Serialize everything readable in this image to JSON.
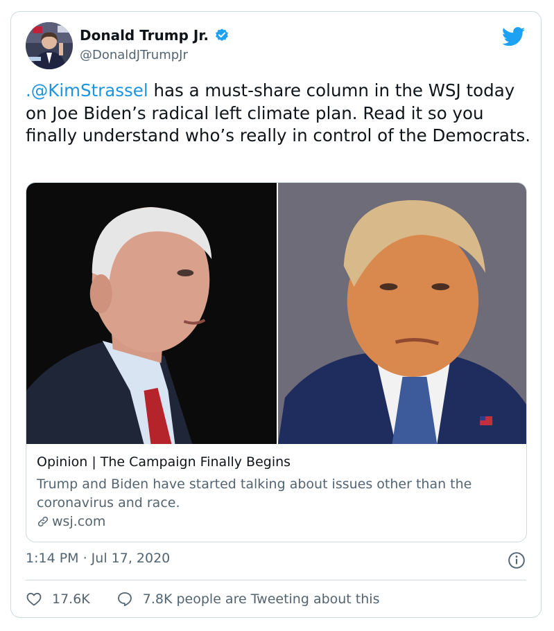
{
  "author": {
    "name": "Donald Trump Jr.",
    "handle": "@DonaldJTrumpJr"
  },
  "tweet": {
    "mention": ".@KimStrassel",
    "text": " has a must-share column in the WSJ today on Joe Biden’s radical left climate plan. Read it so you finally understand who’s really in control of the Democrats."
  },
  "card": {
    "title": "Opinion | The Campaign Finally Begins",
    "description": "Trump and Biden have started talking about issues other than the coronavirus and race.",
    "domain": "wsj.com"
  },
  "meta": {
    "timestamp": "1:14 PM · Jul 17, 2020"
  },
  "actions": {
    "likes": "17.6K",
    "tweeting": "7.8K people are Tweeting about this"
  },
  "colors": {
    "accent": "#1da1f2",
    "link": "#1b95e0",
    "secondary_text": "#536471",
    "border": "#cfd9de"
  },
  "icons": [
    "verified-badge-icon",
    "twitter-bird-icon",
    "link-icon",
    "info-icon",
    "heart-icon",
    "comment-icon"
  ]
}
